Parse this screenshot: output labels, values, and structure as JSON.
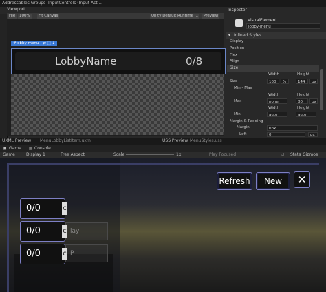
{
  "top_tabs": {
    "addressables": "Addressables Groups",
    "input": "InputControls (Input Acti..."
  },
  "viewport": {
    "title": "Viewport",
    "file": "File",
    "zoom": "100%",
    "fit": "Fit Canvas",
    "runtime": "Unity Default Runtime ...",
    "preview": "Preview"
  },
  "lobby": {
    "tag": "#lobby-menu",
    "name": "LobbyName",
    "count": "0/8"
  },
  "inspector": {
    "title": "Inspector",
    "element_type": "VisualElement",
    "element_name": "lobby-menu",
    "inlined_styles": "Inlined Styles",
    "sections": [
      "Display",
      "Position",
      "Flex",
      "Align",
      "Size"
    ],
    "size": {
      "width_label": "Width",
      "height_label": "Height",
      "size_label": "Size",
      "width": "100",
      "width_unit": "%",
      "height": "144",
      "height_unit": "px",
      "minmax": "Min - Max",
      "max_label": "Max",
      "max_w": "none",
      "max_h": "80",
      "max_unit": "px",
      "min_label": "Min",
      "min_w": "auto",
      "min_h": "auto"
    },
    "margin_section": "Margin & Padding",
    "margin_label": "Margin",
    "margin_val": "0px",
    "left_label": "Left",
    "left_val": "0",
    "left_unit": "px"
  },
  "bottom_tabs": {
    "uxml": "UXML Preview",
    "uxml_file": "MenuLobbyListItem.uxml",
    "uss": "USS Preview",
    "uss_file": "MenuStyles.uss"
  },
  "game_tabs": {
    "game": "Game",
    "console": "Console"
  },
  "game_toolbar": {
    "game": "Game",
    "display": "Display 1",
    "aspect": "Free Aspect",
    "scale": "Scale",
    "scale_val": "1x",
    "play_focused": "Play Focused",
    "stats": "Stats",
    "gizmos": "Gizmos"
  },
  "game_ui": {
    "refresh": "Refresh",
    "new": "New",
    "close": "✕",
    "slots": [
      "0/0",
      "0/0",
      "0/0"
    ],
    "ghost_labels": [
      "lay",
      "P"
    ]
  }
}
